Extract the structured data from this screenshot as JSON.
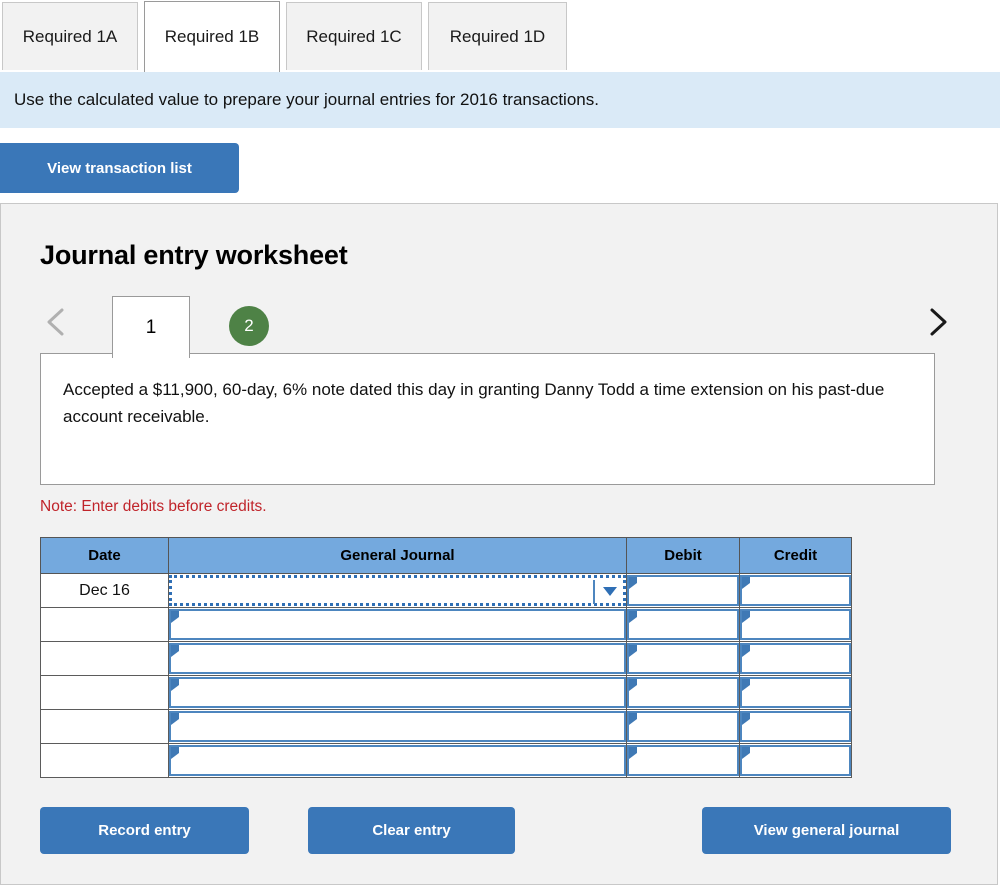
{
  "tabs": [
    {
      "label": "Required 1A",
      "active": false
    },
    {
      "label": "Required 1B",
      "active": true
    },
    {
      "label": "Required 1C",
      "active": false
    },
    {
      "label": "Required 1D",
      "active": false
    }
  ],
  "banner": {
    "text": "Use the calculated value to prepare your journal entries for 2016 transactions."
  },
  "toolbar": {
    "view_transaction_list_label": "View transaction list"
  },
  "worksheet": {
    "title": "Journal entry worksheet",
    "pager": {
      "prev_icon": "chevron-left-icon",
      "next_icon": "chevron-right-icon",
      "pages": [
        {
          "label": "1",
          "state": "active"
        },
        {
          "label": "2",
          "state": "completed"
        }
      ]
    },
    "description": "Accepted a $11,900, 60-day, 6% note dated this day in granting Danny Todd a time extension on his past-due account receivable.",
    "note": "Note: Enter debits before credits.",
    "table": {
      "headers": [
        "Date",
        "General Journal",
        "Debit",
        "Credit"
      ],
      "rows": [
        {
          "date": "Dec 16",
          "journal": "",
          "debit": "",
          "credit": "",
          "selected": true
        },
        {
          "date": "",
          "journal": "",
          "debit": "",
          "credit": "",
          "selected": false
        },
        {
          "date": "",
          "journal": "",
          "debit": "",
          "credit": "",
          "selected": false
        },
        {
          "date": "",
          "journal": "",
          "debit": "",
          "credit": "",
          "selected": false
        },
        {
          "date": "",
          "journal": "",
          "debit": "",
          "credit": "",
          "selected": false
        },
        {
          "date": "",
          "journal": "",
          "debit": "",
          "credit": "",
          "selected": false
        }
      ],
      "dropdown_icon": "chevron-down-icon"
    },
    "actions": {
      "record_label": "Record entry",
      "clear_label": "Clear entry",
      "view_journal_label": "View general journal"
    }
  },
  "colors": {
    "primary_blue": "#3a77b8",
    "banner_blue": "#daeaf7",
    "header_blue": "#74a9de",
    "badge_green": "#4e8246",
    "note_red": "#c0242a",
    "panel_gray": "#f2f2f2"
  }
}
